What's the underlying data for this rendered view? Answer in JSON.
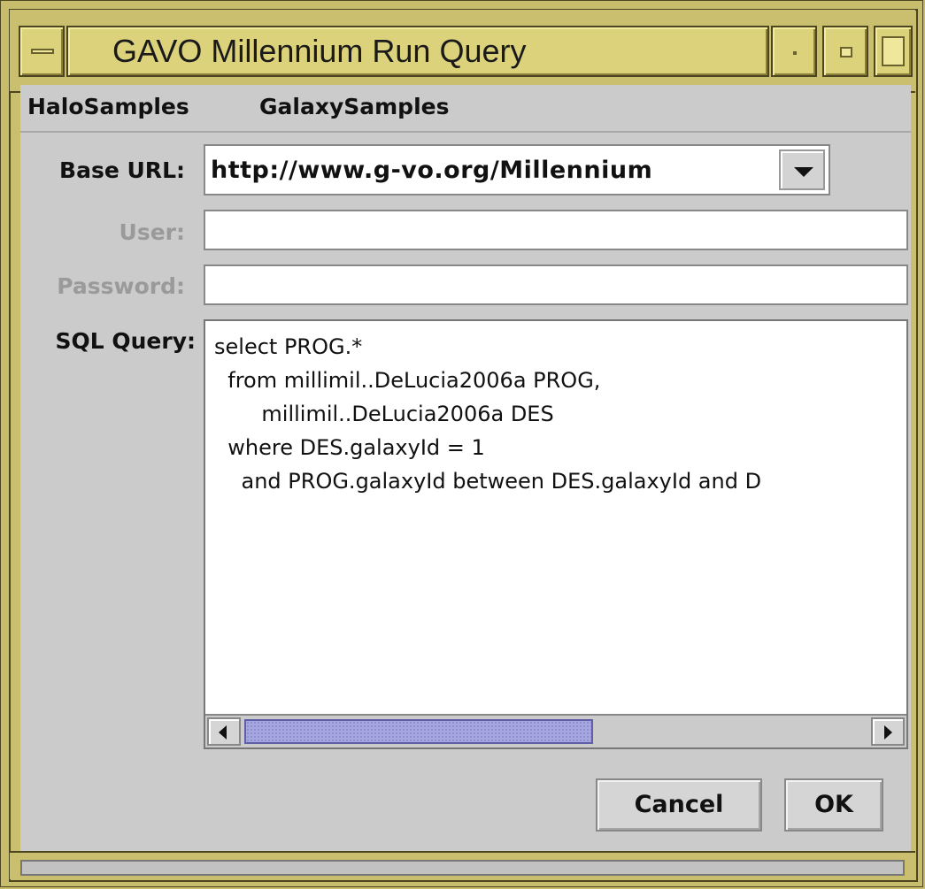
{
  "window": {
    "title": "GAVO Millennium Run Query",
    "controls": [
      "window-menu-icon",
      "minimize-icon",
      "maximize-icon",
      "close-icon"
    ]
  },
  "menubar": {
    "items": [
      "HaloSamples",
      "GalaxySamples"
    ]
  },
  "form": {
    "base_url_label": "Base URL:",
    "base_url_value": "http://www.g-vo.org/Millennium",
    "user_label": "User:",
    "user_value": "",
    "password_label": "Password:",
    "password_value": "",
    "sql_label": "SQL Query:",
    "sql_text": "select PROG.*\n  from millimil..DeLucia2006a PROG,\n       millimil..DeLucia2006a DES\n  where DES.galaxyId = 1\n    and PROG.galaxyId between DES.galaxyId and D"
  },
  "buttons": {
    "cancel": "Cancel",
    "ok": "OK"
  },
  "colors": {
    "frame": "#c9bf6f",
    "client": "#cbcbcb",
    "scroll_thumb": "#a6a6e0"
  }
}
